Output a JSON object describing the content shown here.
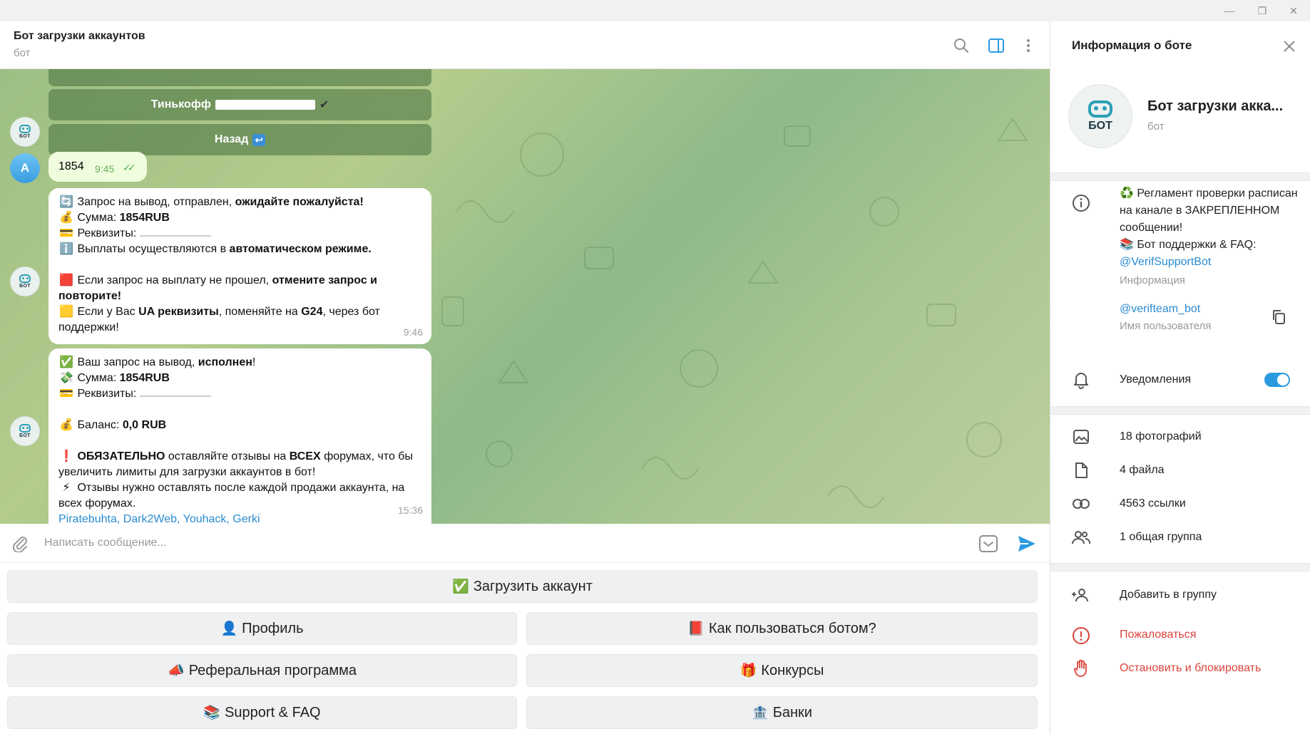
{
  "window": {
    "minimize": "—",
    "maximize": "❐",
    "close": "✕"
  },
  "header": {
    "title": "Бот загрузки аккаунтов",
    "subtitle": "бот"
  },
  "chat": {
    "inline_buttons": [
      {
        "label": "Тинькофф",
        "suffix": "✔"
      },
      {
        "label": "Назад",
        "suffix": "↩"
      }
    ],
    "avatar_bot_label": "БОТ",
    "avatar_user_letter": "A",
    "outgoing": {
      "text": "1854",
      "time": "9:45"
    },
    "msg1": {
      "l1_emoji": "🔄",
      "l1_a": "Запрос на вывод,  отправлен,",
      "l1_b": "ожидайте пожалуйста!",
      "l2_emoji": "💰",
      "l2_a": "Сумма:",
      "l2_b": "1854RUB",
      "l3_emoji": "💳",
      "l3_a": "Реквизиты:",
      "l4_emoji": "ℹ️",
      "l4_a": "Выплаты осуществляются в",
      "l4_b": "автоматическом режиме.",
      "l5_emoji": "🟥",
      "l5_a": "Если запрос на выплату не прошел,",
      "l5_b": "отмените запрос и повторите!",
      "l6_emoji": "🟨",
      "l6_a": "Если у Вас",
      "l6_b": "UA реквизиты",
      "l6_c": ", поменяйте на",
      "l6_d": "G24",
      "l6_e": ", через бот поддержки!",
      "time": "9:46"
    },
    "msg2": {
      "l1_emoji": "✅",
      "l1_a": "Ваш запрос на вывод,",
      "l1_b": "исполнен",
      "l1_c": "!",
      "l2_emoji": "💸",
      "l2_a": "Сумма:",
      "l2_b": "1854RUB",
      "l3_emoji": "💳",
      "l3_a": "Реквизиты:",
      "l4_emoji": "💰",
      "l4_a": "Баланс:",
      "l4_b": "0,0 RUB",
      "l5_emoji": "❗",
      "l5_a": "ОБЯЗАТЕЛЬНО",
      "l5_b": "оставляйте отзывы на",
      "l5_c": "ВСЕХ",
      "l5_d": "форумах, что бы увеличить лимиты для загрузки аккаунтов в бот!",
      "l6_emoji": "⚡",
      "l6_a": "Отзывы нужно оставлять после каждой продажи аккаунта, на всех форумах.",
      "l7_link": "Piratebuhta, Dark2Web, Youhack, Gerki",
      "time": "15:36"
    }
  },
  "input": {
    "placeholder": "Написать сообщение..."
  },
  "keyboard": {
    "upload": {
      "emoji": "✅",
      "label": "Загрузить аккаунт"
    },
    "profile": {
      "emoji": "👤",
      "label": "Профиль"
    },
    "howto": {
      "emoji": "📕",
      "label": "Как пользоваться ботом?"
    },
    "referral": {
      "emoji": "📣",
      "label": "Реферальная программа"
    },
    "contests": {
      "emoji": "🎁",
      "label": "Конкурсы"
    },
    "support": {
      "emoji": "📚",
      "label": "Support & FAQ"
    },
    "banks": {
      "emoji": "🏦",
      "label": "Банки"
    }
  },
  "info_panel": {
    "title": "Информация о боте",
    "avatar_label": "БОТ",
    "name": "Бот загрузки акка...",
    "type": "бот",
    "description_1": "♻️ Регламент проверки расписан на канале в ЗАКРЕПЛЕННОМ сообщении!",
    "description_2": "📚 Бот поддержки & FAQ:",
    "description_link": "@VerifSupportBot",
    "description_caption": "Информация",
    "username": "@verifteam_bot",
    "username_caption": "Имя пользователя",
    "notifications": "Уведомления",
    "photos": "18 фотографий",
    "files": "4 файла",
    "links": "4563 ссылки",
    "groups": "1 общая группа",
    "add_to_group": "Добавить в группу",
    "report": "Пожаловаться",
    "block": "Остановить и блокировать"
  },
  "colors": {
    "accent": "#2a9ae0",
    "danger": "#d9433b",
    "bubble_out": "#effdde"
  }
}
